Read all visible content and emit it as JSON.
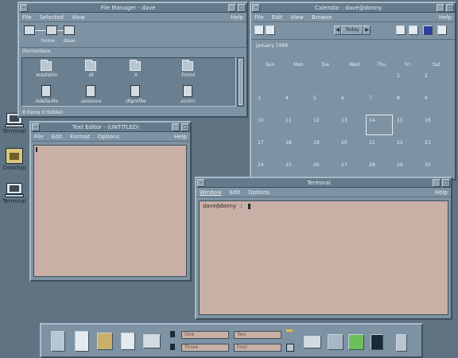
{
  "file_manager": {
    "title": "File Manager - dave",
    "menus": [
      "File",
      "Selected",
      "View"
    ],
    "help": "Help",
    "path_buttons": [
      "home",
      "dave"
    ],
    "location": "/home/dave",
    "files": [
      {
        "name": ".wastebin",
        "type": "folder"
      },
      {
        "name": ".dt",
        "type": "folder"
      },
      {
        "name": ".X",
        "type": "folder"
      },
      {
        "name": ".fmovi",
        "type": "folder"
      },
      {
        "name": ".Xdefaults",
        "type": "doc"
      },
      {
        "name": ".sessions",
        "type": "doc"
      },
      {
        "name": ".dtprofile",
        "type": "doc"
      },
      {
        "name": ".xinitrc",
        "type": "doc"
      }
    ],
    "status": "8 Items 9 Hidden"
  },
  "calendar": {
    "title": "Calendar : dave@donny",
    "menus": [
      "File",
      "Edit",
      "View",
      "Browse"
    ],
    "help": "Help",
    "today_label": "Today",
    "month_label": "January 1999",
    "weekdays": [
      "Sun",
      "Mon",
      "Tue",
      "Wed",
      "Thu",
      "Fri",
      "Sat"
    ],
    "weeks": [
      [
        "",
        "",
        "",
        "",
        "",
        "1",
        "2"
      ],
      [
        "3",
        "4",
        "5",
        "6",
        "7",
        "8",
        "9"
      ],
      [
        "10",
        "11",
        "12",
        "13",
        "14",
        "15",
        "16"
      ],
      [
        "17",
        "18",
        "19",
        "20",
        "21",
        "22",
        "23"
      ],
      [
        "24",
        "25",
        "26",
        "27",
        "28",
        "29",
        "30"
      ],
      [
        "31",
        "",
        "",
        "",
        "",
        "",
        ""
      ]
    ],
    "selected": "13"
  },
  "text_editor": {
    "title": "Text Editor - (UNTITLED)",
    "menus": [
      "File",
      "Edit",
      "Format",
      "Options"
    ],
    "help": "Help"
  },
  "terminal": {
    "title": "Terminal",
    "menus": [
      "Window",
      "Edit",
      "Options"
    ],
    "help": "Help",
    "prompt": "dave@donny :"
  },
  "desktop_icons": [
    {
      "label": "Terminal"
    },
    {
      "label": "Desktop"
    },
    {
      "label": "Terminal"
    }
  ],
  "front_panel": {
    "workspaces": [
      "One",
      "Two",
      "Three",
      "Four"
    ]
  },
  "colors": {
    "background": "#5f7383",
    "window": "#7d92a3",
    "text_area": "#c8b0a6"
  }
}
